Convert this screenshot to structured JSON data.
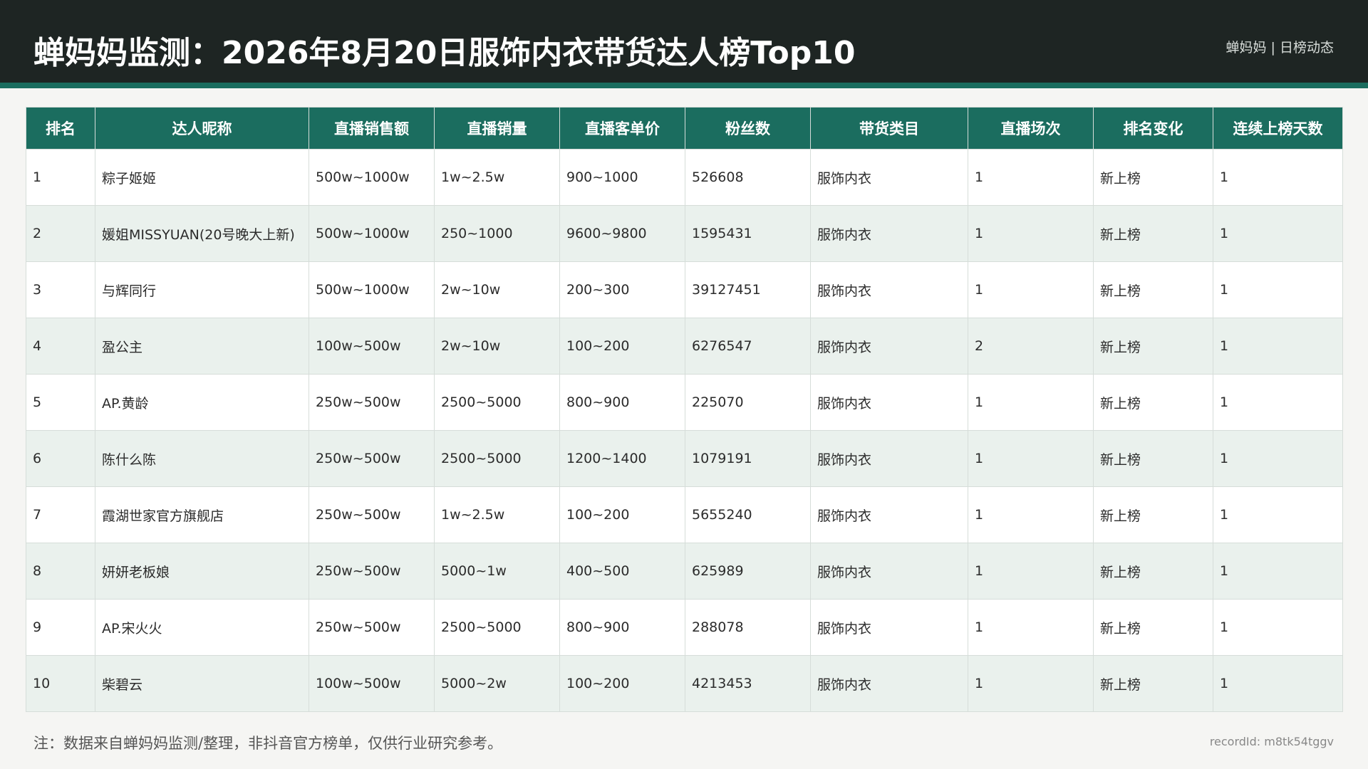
{
  "header": {
    "title": "蝉妈妈监测：2026年8月20日服饰内衣带货达人榜Top10",
    "brand": "蝉妈妈 | 日榜动态"
  },
  "table": {
    "columns": [
      "排名",
      "达人昵称",
      "直播销售额",
      "直播销量",
      "直播客单价",
      "粉丝数",
      "带货类目",
      "直播场次",
      "排名变化",
      "连续上榜天数"
    ],
    "rows": [
      [
        "1",
        "粽子姬姬",
        "500w~1000w",
        "1w~2.5w",
        "900~1000",
        "526608",
        "服饰内衣",
        "1",
        "新上榜",
        "1"
      ],
      [
        "2",
        "媛姐MISSYUAN(20号晚大上新)",
        "500w~1000w",
        "250~1000",
        "9600~9800",
        "1595431",
        "服饰内衣",
        "1",
        "新上榜",
        "1"
      ],
      [
        "3",
        "与辉同行",
        "500w~1000w",
        "2w~10w",
        "200~300",
        "39127451",
        "服饰内衣",
        "1",
        "新上榜",
        "1"
      ],
      [
        "4",
        "盈公主",
        "100w~500w",
        "2w~10w",
        "100~200",
        "6276547",
        "服饰内衣",
        "2",
        "新上榜",
        "1"
      ],
      [
        "5",
        "AP.黄龄",
        "250w~500w",
        "2500~5000",
        "800~900",
        "225070",
        "服饰内衣",
        "1",
        "新上榜",
        "1"
      ],
      [
        "6",
        "陈什么陈",
        "250w~500w",
        "2500~5000",
        "1200~1400",
        "1079191",
        "服饰内衣",
        "1",
        "新上榜",
        "1"
      ],
      [
        "7",
        "霞湖世家官方旗舰店",
        "250w~500w",
        "1w~2.5w",
        "100~200",
        "5655240",
        "服饰内衣",
        "1",
        "新上榜",
        "1"
      ],
      [
        "8",
        "妍妍老板娘",
        "250w~500w",
        "5000~1w",
        "400~500",
        "625989",
        "服饰内衣",
        "1",
        "新上榜",
        "1"
      ],
      [
        "9",
        "AP.宋火火",
        "250w~500w",
        "2500~5000",
        "800~900",
        "288078",
        "服饰内衣",
        "1",
        "新上榜",
        "1"
      ],
      [
        "10",
        "柴碧云",
        "100w~500w",
        "5000~2w",
        "100~200",
        "4213453",
        "服饰内衣",
        "1",
        "新上榜",
        "1"
      ]
    ]
  },
  "footer": {
    "note": "注：数据来自蝉妈妈监测/整理，非抖音官方榜单，仅供行业研究参考。",
    "record_id": "recordId: m8tk54tggv"
  },
  "colors": {
    "header_bg": "#1e2523",
    "accent": "#1b6d5f",
    "row_alt": "#eaf1ed"
  }
}
